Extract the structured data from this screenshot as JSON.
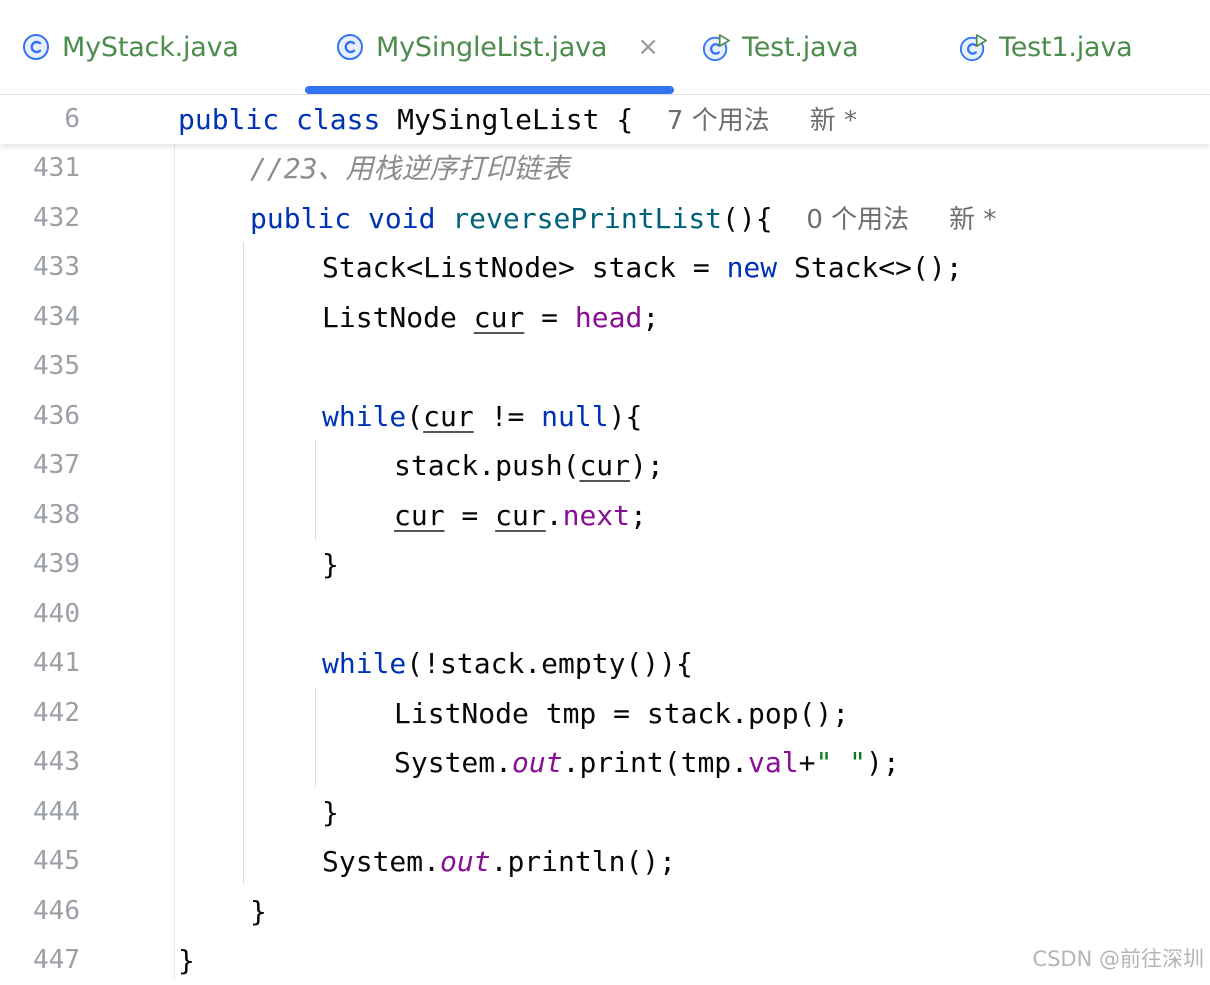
{
  "tabs": [
    {
      "label": "MyStack.java",
      "icon": "class-icon"
    },
    {
      "label": "MySingleList.java",
      "icon": "class-icon",
      "active": true,
      "close": "×"
    },
    {
      "label": "Test.java",
      "icon": "run-class-icon"
    },
    {
      "label": "Test1.java",
      "icon": "run-class-icon"
    }
  ],
  "colors": {
    "tab_text": "#4c8c4c",
    "accent": "#3574f0",
    "keyword": "#0033b3",
    "method": "#00627a",
    "field": "#871094",
    "string": "#067d17",
    "comment": "#8c8c8c"
  },
  "sticky": {
    "line": "6",
    "kw1": "public",
    "kw2": "class",
    "name": "MySingleList {",
    "usages": "7 个用法",
    "new": "新 *"
  },
  "lines": [
    {
      "n": "431"
    },
    {
      "n": "432"
    },
    {
      "n": "433"
    },
    {
      "n": "434"
    },
    {
      "n": "435"
    },
    {
      "n": "436"
    },
    {
      "n": "437"
    },
    {
      "n": "438"
    },
    {
      "n": "439"
    },
    {
      "n": "440"
    },
    {
      "n": "441"
    },
    {
      "n": "442"
    },
    {
      "n": "443"
    },
    {
      "n": "444"
    },
    {
      "n": "445"
    },
    {
      "n": "446"
    },
    {
      "n": "447"
    }
  ],
  "code": {
    "l431": "//23、用栈逆序打印链表",
    "l432": {
      "kw1": "public",
      "kw2": "void",
      "fn": "reversePrintList",
      "rest": "(){",
      "usages": "0 个用法",
      "new": "新 *"
    },
    "l433": {
      "a": "Stack<ListNode> stack = ",
      "kw": "new",
      "b": " Stack<>();"
    },
    "l434": {
      "a": "ListNode ",
      "var": "cur",
      "b": " = ",
      "fld": "head",
      "c": ";"
    },
    "l436": {
      "kw": "while",
      "a": "(",
      "var": "cur",
      "b": " != ",
      "kw2": "null",
      "c": "){"
    },
    "l437": {
      "a": "stack.push(",
      "var": "cur",
      "b": ");"
    },
    "l438": {
      "var1": "cur",
      "a": " = ",
      "var2": "cur",
      "b": ".",
      "fld": "next",
      "c": ";"
    },
    "l439": "}",
    "l441": {
      "kw": "while",
      "a": "(!stack.empty()){"
    },
    "l442": "ListNode tmp = stack.pop();",
    "l443": {
      "a": "System.",
      "st": "out",
      "b": ".print(tmp.",
      "fld": "val",
      "c": "+",
      "str": "\" \"",
      "d": ");"
    },
    "l444": "}",
    "l445": {
      "a": "System.",
      "st": "out",
      "b": ".println();"
    },
    "l446": "}",
    "l447": "}"
  },
  "watermark": "CSDN @前往深圳"
}
